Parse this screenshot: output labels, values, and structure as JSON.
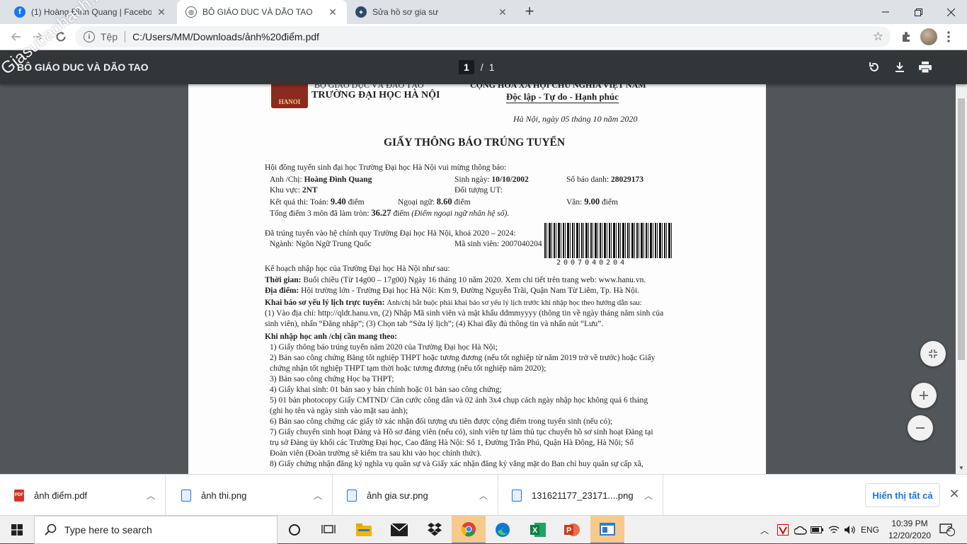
{
  "browser": {
    "tabs": [
      {
        "title": "(1) Hoàng Đình Quang | Faceboo",
        "icon": "facebook-icon",
        "active": false
      },
      {
        "title": "BÔ GIÁO DUC VÀ DÃO TAO",
        "icon": "globe-icon",
        "active": true
      },
      {
        "title": "Sửa hồ sơ gia sư",
        "icon": "site-icon",
        "active": false
      }
    ],
    "new_tab_label": "+",
    "address": {
      "scheme": "Tệp",
      "url": "C:/Users/MM/Downloads/ảnh%20điểm.pdf"
    }
  },
  "pdf_viewer": {
    "title": "BÔ GIÁO DUC VÀ DÃO TAO",
    "current_page": "1",
    "total_pages": "1",
    "watermark": "Giasubaohanh.net"
  },
  "document": {
    "ministry": "BỘ GIÁO DỤC VÀ ĐÀO TẠO",
    "university": "TRƯỜNG ĐẠI HỌC HÀ NỘI",
    "seal_text": "HANOI",
    "republic": "CỘNG HÒA XÃ HỘI CHỦ NGHĨA VIỆT NAM",
    "motto": "Độc lập - Tự do - Hạnh phúc",
    "date_line": "Hà Nội, ngày 05 tháng 10 năm 2020",
    "heading": "GIẤY THÔNG BÁO TRÚNG TUYỂN",
    "greeting": "Hội đồng tuyển sinh đại học Trường Đại học Hà Nội vui mừng thông báo:",
    "name_label": "Anh /Chị:",
    "name": "Hoàng Đình Quang",
    "dob_label": "Sinh ngày:",
    "dob": "10/10/2002",
    "sbd_label": "Số báo danh:",
    "sbd": "28029173",
    "region_label": "Khu vực:",
    "region": "2NT",
    "target_label": "Đối tượng UT:",
    "result_label": "Kết quả thi: Toán:",
    "math": "9.40",
    "unit": "điểm",
    "lang_label": "Ngoại ngữ:",
    "lang": "8.60",
    "lit_label": "Văn:",
    "lit": "9.00",
    "total_label": "Tổng điểm 3 môn đã làm tròn:",
    "total": "36.27",
    "total_note": "(Điểm ngoại ngữ nhân hệ số).",
    "admit_line": "Đã trúng tuyển vào hệ chính quy Trường Đại học Hà Nội,  khoá 2020 – 2024:",
    "major_line": "Ngành: Ngôn Ngữ Trung Quốc",
    "student_id_line": "Mã sinh viên: 2007040204",
    "barcode_digits": "2007040204",
    "plan_line": "Kế hoạch nhập học của Trường Đại học Hà Nội như sau:",
    "time_label": "Thời gian:",
    "time_text": "Buổi chiều (Từ 14g00 – 17g00) Ngày 16 tháng 10 năm 2020. Xem chi tiết trên trang web: www.hanu.vn.",
    "place_label": "Địa điểm:",
    "place_text": "Hội  trường lớn - Trường Đại học Hà Nội: Km 9, Đường Nguyễn Trãi, Quận Nam Từ Liêm, Tp. Hà Nội.",
    "declare_label": "Khai báo sơ yếu lý lịch trực tuyến:",
    "declare_text": "Anh/chị bắt buộc phải khai báo sơ yếu lý lịch trước khi nhập học theo hướng dẫn sau:",
    "declare_line2": "(1) Vào địa chỉ: http://qldt.hanu.vn, (2) Nhập Mã sinh viên và mật khẩu ddmmyyyy (thông tin về ngày tháng năm sinh của",
    "declare_line3": "sinh viên), nhấn “Đăng nhập”; (3) Chọn tab “Sửa lý lịch”; (4) Khai đầy đủ thông tin và nhấn nút “Lưu”.",
    "bring_label": "Khi nhập học anh /chị cần mang theo:",
    "items": [
      "1)   Giấy thông báo trúng tuyển năm 2020 của Trường Đại học Hà Nội;",
      "2)   Bản sao công chứng Bằng tốt nghiệp THPT hoặc tương đương (nếu tốt nghiệp từ năm 2019 trở về trước) hoặc Giấy",
      "        chứng nhận tốt nghiệp THPT tạm thời hoặc tương đương (nếu tốt nghiệp năm 2020);",
      "3)   Bản sao công chứng Học bạ THPT;",
      "4)   Giấy khai sinh: 01 bản sao y bản chính hoặc 01 bản sao công chứng;",
      "5)   01 bản photocopy Giấy CMTND/ Căn cước công dân và 02 ảnh 3x4 chụp cách ngày nhập học không quá 6 tháng",
      "        (ghi họ tên và ngày sinh vào mặt sau ảnh);",
      "6)   Bản sao công chứng các giấy tờ xác nhận đối tượng ưu tiên được cộng điểm trong tuyển sinh (nếu có);",
      "7)   Giấy chuyển sinh hoạt Đảng và Hồ sơ đảng viên (nếu có), sinh viên tự làm thủ tục chuyển hồ sơ sinh hoạt Đảng tại",
      "        trụ sở Đảng ủy khối các Trường Đại học, Cao đẳng Hà Nội: Số 1, Đường Trần Phú, Quận Hà Đông, Hà Nội;  Sổ",
      "        Đoàn viên (Đoàn trường sẽ kiểm tra sau khi vào học chính thức).",
      "8)   Giấy chứng nhận đăng ký nghĩa vụ quân sự và Giấy xác nhận đăng ký vắng mặt do Ban chỉ huy quân sự cấp xã,"
    ]
  },
  "downloads": {
    "items": [
      {
        "name": "ảnh điểm.pdf",
        "type": "pdf-icon"
      },
      {
        "name": "ảnh thi.png",
        "type": "image-file-icon"
      },
      {
        "name": "ảnh gia sư.png",
        "type": "image-file-icon"
      },
      {
        "name": "131621177_23171....png",
        "type": "image-file-icon"
      }
    ],
    "show_all": "Hiển thị tất cả"
  },
  "taskbar": {
    "search_placeholder": "Type here to search",
    "language": "ENG",
    "time": "10:39 PM",
    "date": "12/20/2020",
    "notification_count": "2"
  },
  "colors": {
    "chrome_tabstrip": "#dee1e6",
    "pdf_toolbar": "#323639",
    "viewer_bg": "#525659",
    "accent": "#1a73e8"
  }
}
